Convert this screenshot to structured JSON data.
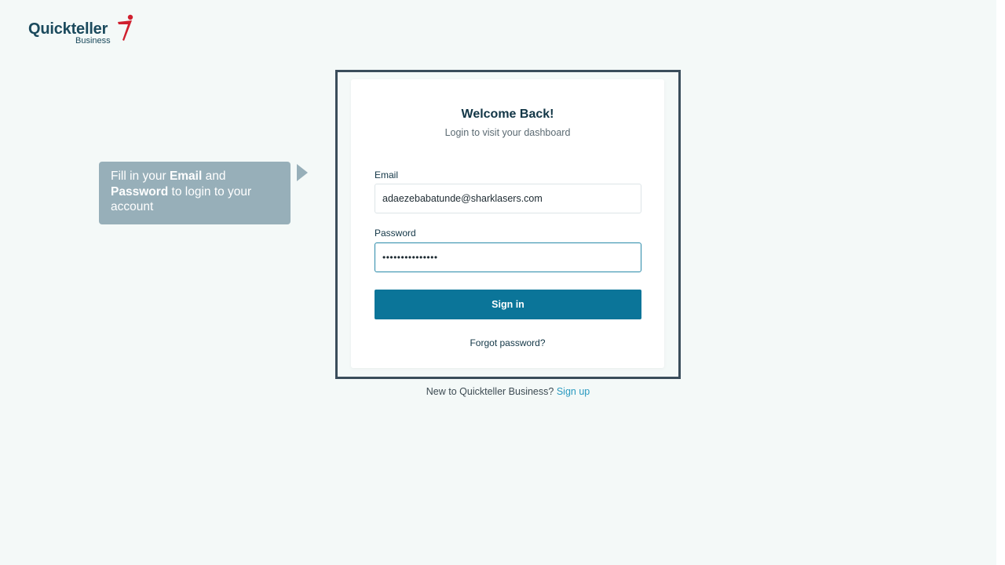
{
  "brand": {
    "name": "Quickteller",
    "subname": "Business",
    "mark_color": "#d0202f",
    "primary_color": "#0b7599"
  },
  "tooltip": {
    "pre1": "Fill in your ",
    "bold1": "Email",
    "mid": " and ",
    "bold2": "Password",
    "post": " to login to your account"
  },
  "login": {
    "title": "Welcome Back!",
    "subtitle": "Login to visit your dashboard",
    "email_label": "Email",
    "email_value": "adaezebabatunde@sharklasers.com",
    "password_label": "Password",
    "password_masked": "•••••••••••••••",
    "sign_in_label": "Sign in",
    "forgot_label": "Forgot password?"
  },
  "footer": {
    "prompt": "New to Quickteller Business?",
    "signup_label": "Sign up"
  }
}
